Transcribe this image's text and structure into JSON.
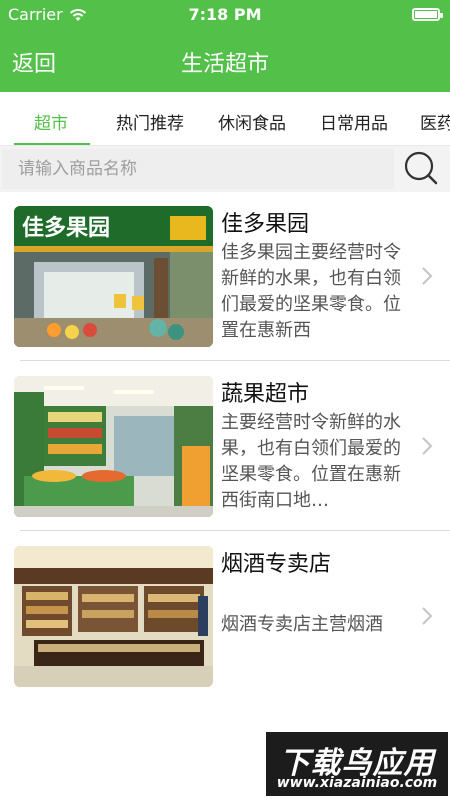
{
  "status": {
    "carrier": "Carrier",
    "time": "7:18 PM",
    "battery_level": 1.0
  },
  "nav": {
    "back_label": "返回",
    "title": "生活超市"
  },
  "tabs": [
    {
      "label": "超市",
      "active": true
    },
    {
      "label": "热门推荐",
      "active": false
    },
    {
      "label": "休闲食品",
      "active": false
    },
    {
      "label": "日常用品",
      "active": false
    },
    {
      "label": "医药",
      "active": false
    }
  ],
  "search": {
    "placeholder": "请输入商品名称",
    "value": "",
    "icon": "search-icon"
  },
  "stores": [
    {
      "name": "佳多果园",
      "description": "佳多果园主要经营时令新鲜的水果，也有白领们最爱的坚果零食。位置在惠新西",
      "thumb_sign_text": "佳多果园"
    },
    {
      "name": "蔬果超市",
      "description": "主要经营时令新鲜的水果，也有白领们最爱的坚果零食。位置在惠新西街南口地…"
    },
    {
      "name": "烟酒专卖店",
      "description": "烟酒专卖店主营烟酒"
    }
  ],
  "watermark": {
    "title": "下载鸟应用",
    "url": "www.xiazainiao.com"
  },
  "colors": {
    "primary": "#53c04a",
    "divider": "#dcdcdc",
    "search_bg": "#eeeeee"
  }
}
